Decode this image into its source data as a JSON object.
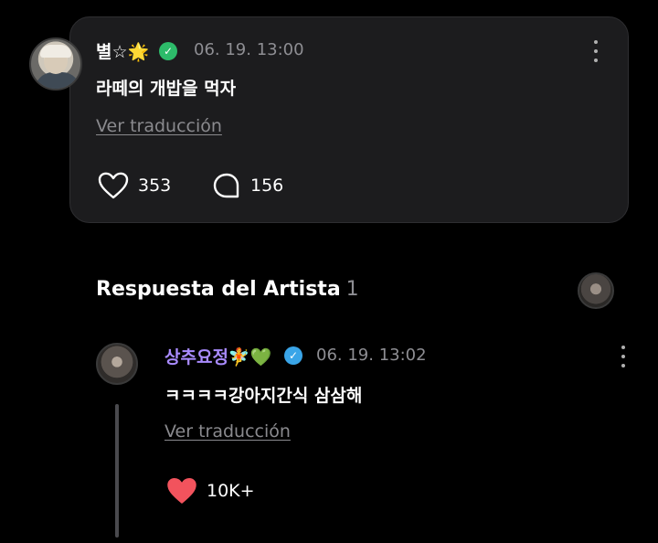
{
  "post": {
    "username": "별☆🌟",
    "timestamp": "06. 19. 13:00",
    "text": "라떼의 개밥을 먹자",
    "translate_label": "Ver traducción",
    "likes": "353",
    "comments": "156"
  },
  "section": {
    "title": "Respuesta del Artista",
    "count": "1"
  },
  "reply": {
    "username": "상추요정🧚💚",
    "timestamp": "06. 19. 13:02",
    "text": "ㅋㅋㅋㅋ강아지간식 삼삼해",
    "translate_label": "Ver traducción",
    "likes": "10K+"
  },
  "colors": {
    "background": "#000000",
    "card": "#1c1c1e",
    "artist_name": "#a98bff",
    "verified_green": "#2dbb6a",
    "verified_blue": "#3aa5e8",
    "liked_heart": "#f2535d",
    "muted_text": "#8e8e93"
  },
  "icons": {
    "more": "more-vertical-icon",
    "like": "heart-icon",
    "comment": "comment-bubble-icon",
    "verified": "verified-badge-icon"
  }
}
